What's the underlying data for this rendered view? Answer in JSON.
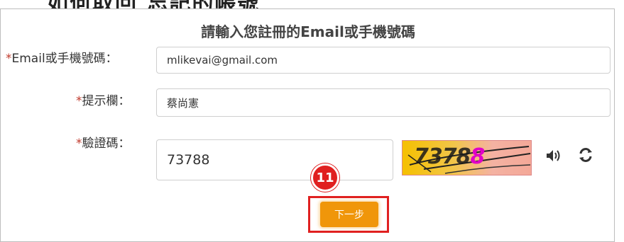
{
  "colors": {
    "required": "#c0392b",
    "submit": "#f0960a",
    "highlight": "#e02020",
    "captcha_accent": "#e000c8"
  },
  "top_title_partial": "如何取回 忘記的帳號",
  "form": {
    "title": "請輸入您註冊的Email或手機號碼",
    "email_label": "Email或手機號碼：",
    "email_value": "mlikevai@gmail.com",
    "hint_label": "提示欄：",
    "hint_value": "蔡尚憲",
    "code_label": "驗證碼：",
    "code_value": "73788",
    "required_mark": "*",
    "captcha": {
      "digits_main": "7378",
      "digits_last": "8"
    },
    "audio_icon": "speaker-icon",
    "refresh_icon": "refresh-icon",
    "submit_label": "下一步"
  },
  "annotation": {
    "step_number": "11"
  }
}
